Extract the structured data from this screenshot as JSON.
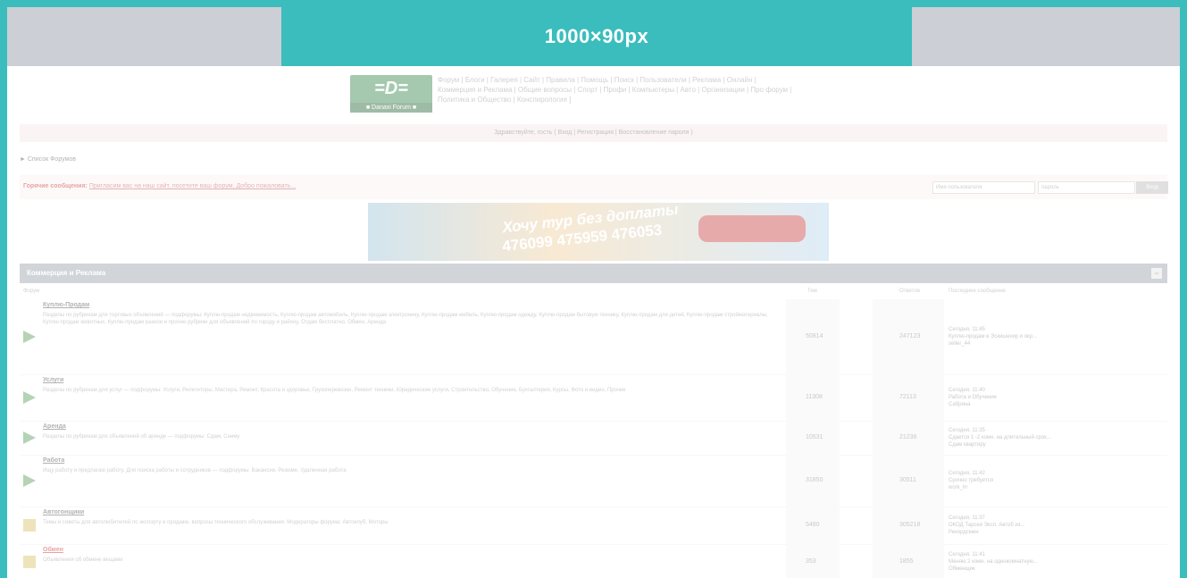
{
  "ad_label": "1000×90px",
  "logo": {
    "mark": "=D=",
    "caption": "■ Danaxi Forum ■"
  },
  "nav": {
    "line1": "Форум | Блоги | Галерея | Сайт | Правила | Помощь | Поиск | Пользователи | Реклама | Онлайн |",
    "line2": "Коммерция и Реклама | Общие вопросы | Спорт | Профи | Компьютеры | Авто | Организации | Про форум |",
    "line3": "Политика и Общество | Конспирология ]"
  },
  "login_bar": "Здравствуйте, гость ( Вход | Регистрация | Восстановление пароля )",
  "forum_list": "► Список Форумов",
  "hot_message": {
    "label": "Горячие сообщения:",
    "link": "Пригласим вас на наш сайт, посетите ваш форум, Добро пожаловать..."
  },
  "search": {
    "field1": "Имя пользователя",
    "field2": "пароль",
    "button": "Вход"
  },
  "promo": {
    "line1": "Хочу тур без доплаты",
    "line2": "476099 475959 476053"
  },
  "category": {
    "title": "Коммерция и Реклама",
    "collapse": "−"
  },
  "columns": {
    "forum": "Форум",
    "topics": "Тем",
    "posts": "Ответов",
    "last": "Последнее сообщение"
  },
  "rows": [
    {
      "title": "Куплю-Продам",
      "desc": "Разделы по рубрикам для торговых объявлений — подфорумы: Куплю-продам недвижимость, Куплю-продам автомобиль, Куплю-продам электронику, Куплю-продам мебель, Куплю-продам одежду, Куплю-продам бытовую технику, Куплю-продам для детей, Куплю-продам стройматериалы, Куплю-продам животных, Куплю-продам разное и прочие рубрики для объявлений по городу и району, Отдам бесплатно, Обмен, Аренда",
      "topics": "50814",
      "posts": "247123",
      "last_time": "Сегодня, 11:45",
      "last_topic": "Куплю-продам в Эскишехир и окр...",
      "last_author": "seller_44"
    },
    {
      "title": "Услуги",
      "desc": "Разделы по рубрикам для услуг — подфорумы: Услуги, Репетиторы, Мастера, Ремонт, Красота и здоровье, Грузоперевозки, Ремонт техники, Юридические услуги, Строительство, Обучение, Бухгалтерия, Курсы, Фото и видео, Прочие",
      "topics": "11308",
      "posts": "72113",
      "last_time": "Сегодня, 11:40",
      "last_topic": "Работа и Обучение",
      "last_author": "Сабрина"
    },
    {
      "title": "Аренда",
      "desc": "Разделы по рубрикам для объявлений об аренде — подфорумы: Сдам, Сниму",
      "topics": "10531",
      "posts": "21236",
      "last_time": "Сегодня, 11:35",
      "last_topic": "Сдается 1 -2 комн. на длительный срок...",
      "last_author": "Сдам квартиру"
    },
    {
      "title": "Работа",
      "desc": "Ищу работу и предлагаю работу. Для поиска работы и сотрудников — подфорумы: Вакансии, Резюме, Удаленная работа",
      "topics": "31850",
      "posts": "30511",
      "last_time": "Сегодня, 11:42",
      "last_topic": "Срочно требуется",
      "last_author": "work_hr"
    },
    {
      "title": "Автогонщики",
      "desc": "Темы и советы для автолюбителей по экспорту и продаже, вопросы технического обслуживания. Модераторы форума: Автоклуб, Моторы",
      "topics": "5480",
      "posts": "305218",
      "last_time": "Сегодня, 11:37",
      "last_topic": "ОКОД Тарсея Эксп. Автоб из...",
      "last_author": "Рекордсмен"
    },
    {
      "title": "Обмен",
      "desc": "Объявления об обмене вещами",
      "topics": "353",
      "posts": "1855",
      "last_time": "Сегодня, 11:41",
      "last_topic": "Меняю 2 комн. на однокомнатную...",
      "last_author": "Обменщик"
    }
  ]
}
